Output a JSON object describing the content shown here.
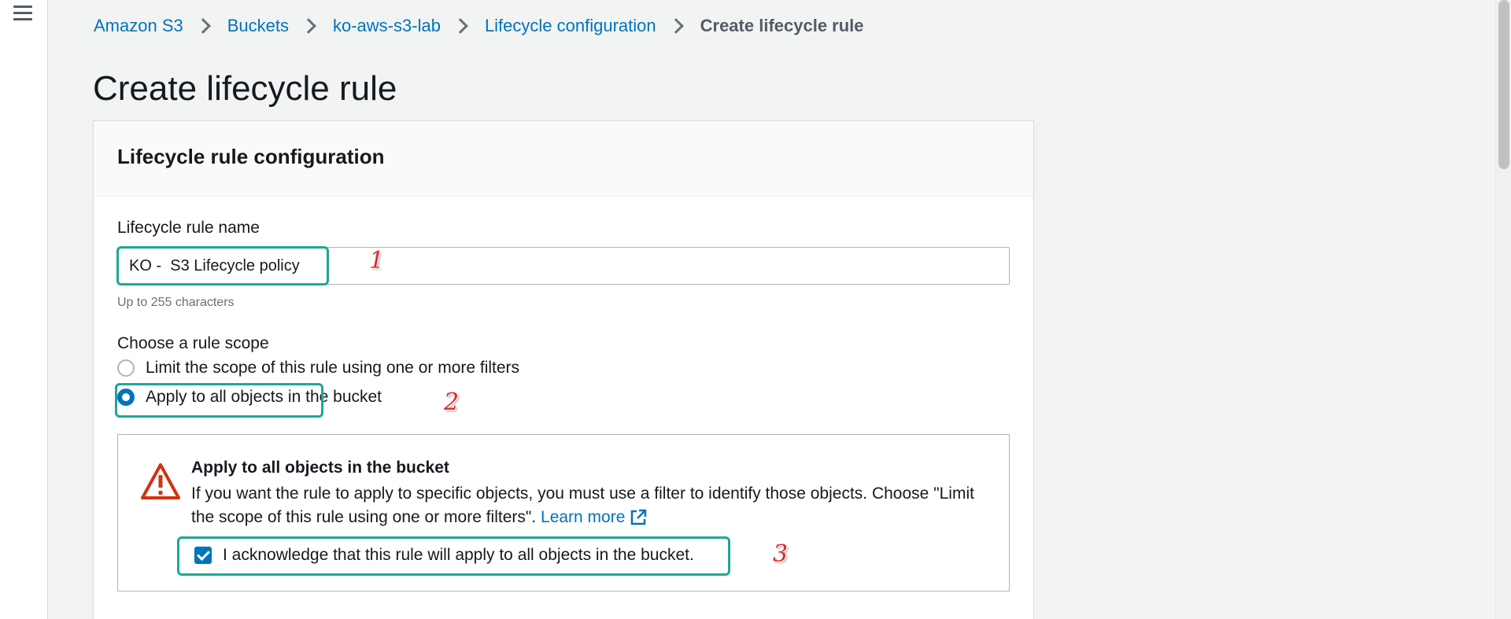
{
  "breadcrumb": [
    "Amazon S3",
    "Buckets",
    "ko-aws-s3-lab",
    "Lifecycle configuration",
    "Create lifecycle rule"
  ],
  "page_title": "Create lifecycle rule",
  "panel": {
    "title": "Lifecycle rule configuration",
    "rule_name": {
      "label": "Lifecycle rule name",
      "value": "KO -  S3 Lifecycle policy",
      "hint": "Up to 255 characters"
    },
    "scope": {
      "label": "Choose a rule scope",
      "options": [
        {
          "label": "Limit the scope of this rule using one or more filters",
          "selected": false
        },
        {
          "label": "Apply to all objects in the bucket",
          "selected": true
        }
      ]
    },
    "alert": {
      "title": "Apply to all objects in the bucket",
      "text": "If you want the rule to apply to specific objects, you must use a filter to identify those objects. Choose \"Limit the scope of this rule using one or more filters\".",
      "link": "Learn more",
      "acknowledge": "I acknowledge that this rule will apply to all objects in the bucket.",
      "acknowledged": true
    }
  },
  "annotations": [
    "1",
    "2",
    "3"
  ],
  "colors": {
    "accent": "#0073bb",
    "highlight": "#1ea896",
    "warning": "#d13212",
    "annotation": "#e02b2b"
  },
  "icons": [
    "menu-icon",
    "chevron-right-icon",
    "warning-icon",
    "external-link-icon",
    "check-icon"
  ]
}
